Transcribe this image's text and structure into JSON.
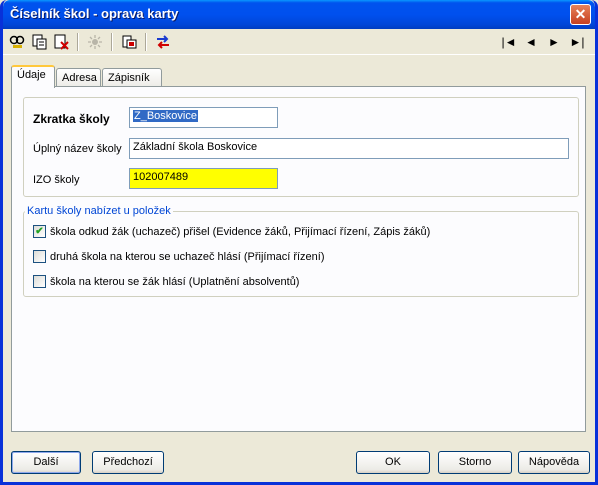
{
  "window": {
    "title": "Číselník škol - oprava karty"
  },
  "toolbar": {
    "buttons": [
      "find-icon",
      "copy-icon",
      "delete-icon",
      "disabled-tool-icon",
      "export-icon",
      "swap-icon"
    ],
    "nav": {
      "first": "|◄",
      "prev": "◄",
      "next": "►",
      "last": "►|"
    }
  },
  "tabs": [
    {
      "label": "Údaje",
      "active": true
    },
    {
      "label": "Adresa",
      "active": false
    },
    {
      "label": "Zápisník",
      "active": false
    }
  ],
  "form": {
    "zkratka": {
      "label": "Zkratka školy",
      "value": "Z_Boskovice"
    },
    "nazev": {
      "label": "Úplný název školy",
      "value": "Základní škola Boskovice"
    },
    "izo": {
      "label": "IZO školy",
      "value": "102007489",
      "highlight": "#ffff00"
    }
  },
  "offer_group": {
    "legend": "Kartu školy nabízet u položek",
    "options": [
      {
        "label": "škola odkud žák (uchazeč) přišel (Evidence žáků, Přijímací řízení, Zápis žáků)",
        "checked": true
      },
      {
        "label": "druhá škola na kterou se uchazeč hlásí (Přijímací řízení)",
        "checked": false
      },
      {
        "label": "škola na kterou se žák hlásí (Uplatnění absolventů)",
        "checked": false
      }
    ]
  },
  "buttons": {
    "next": "Další",
    "prev": "Předchozí",
    "ok": "OK",
    "cancel": "Storno",
    "help": "Nápověda"
  },
  "colors": {
    "title_bar": "#0050ee",
    "accent_legend": "#0046d5",
    "tab_highlight": "#ffc83c"
  }
}
